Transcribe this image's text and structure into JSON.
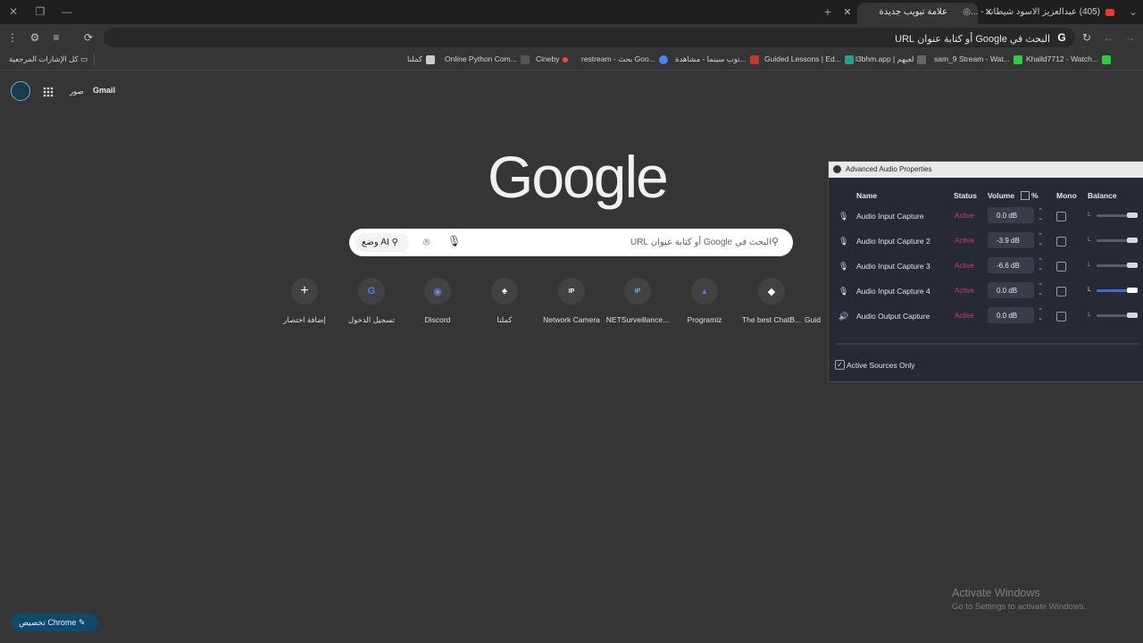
{
  "window": {
    "minimize_icon": "minimize-icon",
    "maximize_icon": "restore-icon",
    "close_icon": "close-icon"
  },
  "tabs": [
    {
      "title": "علامة تبويب جديدة",
      "active": true
    },
    {
      "title": "(405) عبدالعزيز الاسود شيطانه - ...",
      "active": false
    }
  ],
  "toolbar": {
    "omnibox_text": "البحث في Google أو كتابة عنوان URL"
  },
  "bookmarks": {
    "all_label": "كل الإشارات المرجعية",
    "items": [
      {
        "label": "Khaild7712 - Watch...",
        "color": "#2ecc40"
      },
      {
        "label": "sam_9 Stream - Wat...",
        "color": "#2ecc40"
      },
      {
        "label": "l3bhm.app | لعبهم",
        "color": "#888888"
      },
      {
        "label": "Guided Lessons | Ed...",
        "color": "#2a9d8f"
      },
      {
        "label": "توب سينما - مشاهدة...",
        "color": "#c0392b"
      },
      {
        "label": "restream - بحث Goo...",
        "color": "#4285f4"
      },
      {
        "label": "Cineby",
        "color": "#e74c3c"
      },
      {
        "label": "Online Python Com...",
        "color": "#555555"
      },
      {
        "label": "كملنا",
        "color": "#cccccc"
      }
    ]
  },
  "header": {
    "gmail": "Gmail",
    "images": "صور"
  },
  "logo": "Google",
  "search": {
    "placeholder": "البحث في Google أو كتابة عنوان URL",
    "ai_mode": "وضع AI"
  },
  "shortcuts": [
    {
      "label": "إضافة اختصار",
      "glyph": "+"
    },
    {
      "label": "تسجيل الدخول",
      "glyph": "G"
    },
    {
      "label": "Discord",
      "glyph": "◉"
    },
    {
      "label": "كملنا",
      "glyph": "♠"
    },
    {
      "label": "Network Camera",
      "glyph": "IP"
    },
    {
      "label": "NETSurveillance...",
      "glyph": "IP"
    },
    {
      "label": "Programiz",
      "glyph": "▲"
    },
    {
      "label": "The best ChatB...",
      "glyph": "◆"
    },
    {
      "label": "Guid",
      "glyph": ""
    }
  ],
  "customize": "تخصيص Chrome",
  "activation": {
    "line1": "Activate Windows",
    "line2": "Go to Settings to activate Windows."
  },
  "obs": {
    "title": "Advanced Audio Properties",
    "headers": {
      "name": "Name",
      "status": "Status",
      "volume": "Volume",
      "percent": "%",
      "mono": "Mono",
      "balance": "Balance"
    },
    "rows": [
      {
        "name": "Audio Input Capture",
        "status": "Active",
        "volume": "0.0 dB",
        "balance": 1.0,
        "icon": "mic-icon"
      },
      {
        "name": "Audio Input Capture 2",
        "status": "Active",
        "volume": "-3.9 dB",
        "balance": 1.0,
        "icon": "mic-icon"
      },
      {
        "name": "Audio Input Capture 3",
        "status": "Active",
        "volume": "-6.6 dB",
        "balance": 1.0,
        "icon": "mic-icon"
      },
      {
        "name": "Audio Input Capture 4",
        "status": "Active",
        "volume": "0.0 dB",
        "balance": 1.0,
        "icon": "mic-icon"
      },
      {
        "name": "Audio Output Capture",
        "status": "Active",
        "volume": "0.0 dB",
        "balance": 1.0,
        "icon": "speaker-icon"
      }
    ],
    "active_only": "Active Sources Only"
  }
}
